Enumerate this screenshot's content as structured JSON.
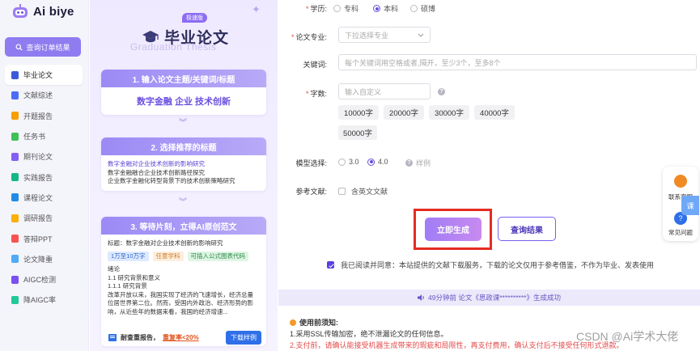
{
  "brand": {
    "name": "Ai biye"
  },
  "sidebar": {
    "query_button": "查询订单结果",
    "items": [
      {
        "label": "毕业论文",
        "color": "#3b5bdb",
        "active": true
      },
      {
        "label": "文献综述",
        "color": "#4c6ef5"
      },
      {
        "label": "开题报告",
        "color": "#f59f00"
      },
      {
        "label": "任务书",
        "color": "#40c057"
      },
      {
        "label": "期刊论文",
        "color": "#845ef7"
      },
      {
        "label": "实践报告",
        "color": "#12b886"
      },
      {
        "label": "课程论文",
        "color": "#228be6"
      },
      {
        "label": "调研报告",
        "color": "#fab005"
      },
      {
        "label": "答辩PPT",
        "color": "#fa5252"
      },
      {
        "label": "论文降重",
        "color": "#4dabf7"
      },
      {
        "label": "AIGC检测",
        "color": "#7950f2"
      },
      {
        "label": "降AIGC率",
        "color": "#20c997"
      }
    ]
  },
  "promo": {
    "badge": "极速版",
    "title": "毕业论文",
    "subtitle": "Graduation Thesis",
    "step1": {
      "head": "1. 输入论文主题/关键词/标题",
      "keywords": "数字金融 企业 技术创新"
    },
    "step2": {
      "head": "2. 选择推荐的标题",
      "titles": [
        "数字金融对企业技术创新的影响研究",
        "数字金融融合企业技术创新路径探究",
        "企业数字金融化转型背景下的技术创新策略研究"
      ]
    },
    "step3": {
      "head": "3. 等待片刻，立得AI原创范文",
      "title_line": "标题：数字金融对企业技术创新的影响研究",
      "tags": [
        "1万至10万字",
        "任意学科",
        "可插入公式图表代码"
      ],
      "body": [
        "绪论",
        "1.1 研究背景和意义",
        "1.1.1 研究背景",
        "改革开放以来，我国实现了经济的飞速增长，经济总量",
        "位居世界第二位。然而，受国内外政治、经济形势的影",
        "响，从近些年的数据来看，我国的经济增速..."
      ],
      "foot_prefix": "耐查重报告，",
      "foot_highlight": "重复率<20%",
      "download": "下载样例"
    }
  },
  "form": {
    "education": {
      "label": "学历:",
      "options": [
        "专科",
        "本科",
        "硕博"
      ],
      "selected": "本科"
    },
    "major": {
      "label": "论文专业:",
      "placeholder": "下拉选择专业"
    },
    "keywords": {
      "label": "关键词:",
      "placeholder": "每个关键词用空格或者,隔开，至少3个，至多8个"
    },
    "words": {
      "label": "字数:",
      "placeholder": "输入自定义",
      "options": [
        "10000字",
        "20000字",
        "30000字",
        "40000字",
        "50000字"
      ]
    },
    "model": {
      "label": "模型选择:",
      "options": [
        "3.0",
        "4.0"
      ],
      "selected": "4.0",
      "sample": "样例"
    },
    "refs": {
      "label": "参考文献:",
      "option": "含英文文献"
    },
    "generate": "立即生成",
    "query": "查询结果",
    "agreement": "我已阅读并同意：本站提供的文献下载服务，下载的论文仅用于参考借鉴，不作为毕业、发表使用",
    "notice": "49分钟前 论文《思政课**********》生成成功",
    "tips_title": "使用前须知:",
    "tips": [
      "1.采用SSL传输加密，绝不泄漏论文的任何信息。",
      "2.支付前，请确认能接受机器生成带来的瑕疵和局限性，再支付费用，确认支付后不接受任何形式退款。"
    ]
  },
  "float": {
    "contact": "联系客服",
    "faq": "常见问题",
    "tab": "课"
  },
  "watermark": "CSDN @Ai学术大佬"
}
